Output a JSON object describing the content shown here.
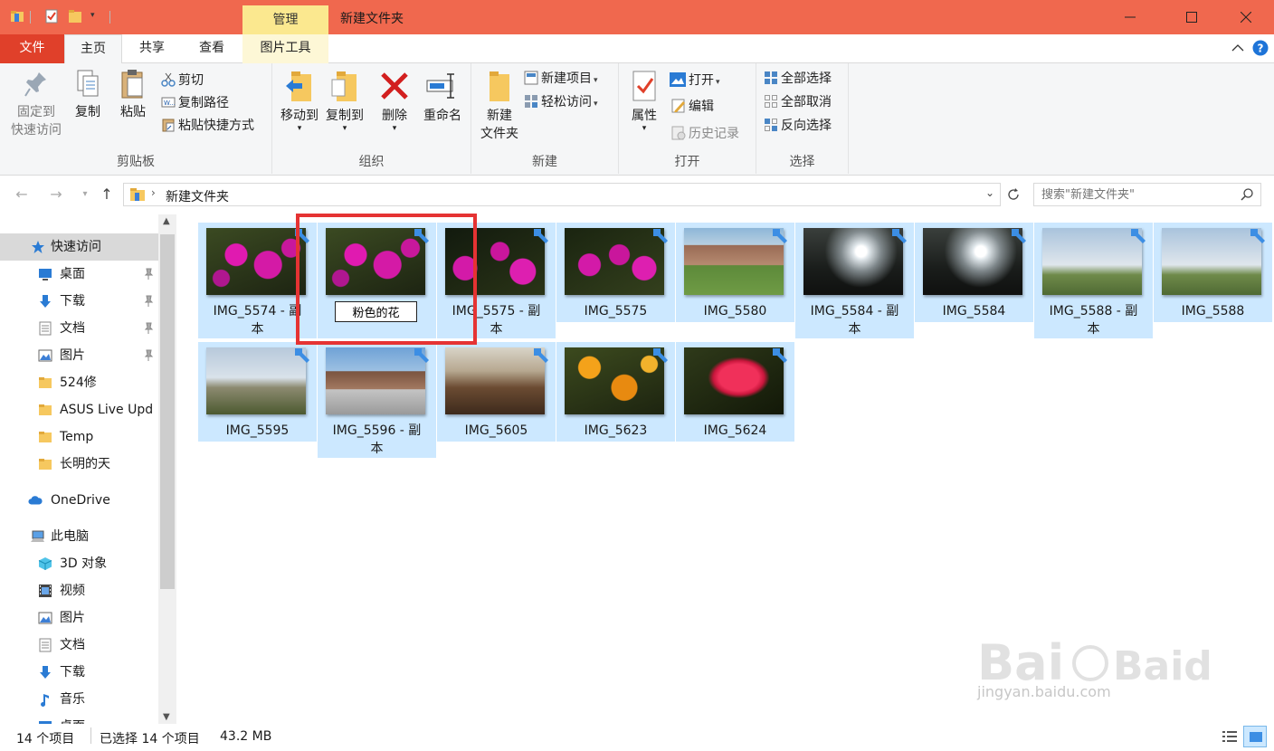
{
  "window": {
    "title": "新建文件夹",
    "context_tab": "管理"
  },
  "tabs": [
    {
      "label": "文件"
    },
    {
      "label": "主页"
    },
    {
      "label": "共享"
    },
    {
      "label": "查看"
    },
    {
      "label": "图片工具"
    }
  ],
  "ribbon": {
    "clipboard": {
      "label": "剪贴板",
      "pin": "固定到\n快速访问",
      "pin_l1": "固定到",
      "pin_l2": "快速访问",
      "copy": "复制",
      "paste": "粘贴",
      "cut": "剪切",
      "copy_path": "复制路径",
      "paste_shortcut": "粘贴快捷方式"
    },
    "organize": {
      "label": "组织",
      "move_to": "移动到",
      "copy_to": "复制到",
      "delete": "删除",
      "rename": "重命名"
    },
    "new": {
      "label": "新建",
      "new_folder_l1": "新建",
      "new_folder_l2": "文件夹",
      "new_item": "新建项目",
      "easy_access": "轻松访问"
    },
    "open": {
      "label": "打开",
      "properties": "属性",
      "open": "打开",
      "edit": "编辑",
      "history": "历史记录"
    },
    "select": {
      "label": "选择",
      "select_all": "全部选择",
      "select_none": "全部取消",
      "invert": "反向选择"
    }
  },
  "address": {
    "path": "新建文件夹",
    "search_placeholder": "搜索\"新建文件夹\""
  },
  "nav": {
    "quick_access": "快速访问",
    "pinned": [
      {
        "label": "桌面",
        "icon": "desktop-icon"
      },
      {
        "label": "下载",
        "icon": "download-icon"
      },
      {
        "label": "文档",
        "icon": "document-icon"
      },
      {
        "label": "图片",
        "icon": "pictures-icon"
      }
    ],
    "folders": [
      {
        "label": "524修"
      },
      {
        "label": "ASUS Live Upd"
      },
      {
        "label": "Temp"
      },
      {
        "label": "长明的天"
      }
    ],
    "onedrive": "OneDrive",
    "this_pc": "此电脑",
    "pc_items": [
      {
        "label": "3D 对象",
        "icon": "3d-objects-icon"
      },
      {
        "label": "视频",
        "icon": "video-icon"
      },
      {
        "label": "图片",
        "icon": "pictures-icon"
      },
      {
        "label": "文档",
        "icon": "document-icon"
      },
      {
        "label": "下载",
        "icon": "download-icon"
      },
      {
        "label": "音乐",
        "icon": "music-icon"
      },
      {
        "label": "桌面",
        "icon": "desktop-icon"
      }
    ]
  },
  "files": [
    {
      "name": "IMG_5574 - 副本",
      "line1": "IMG_5574 - 副",
      "line2": "本",
      "thumb": "pink-flowers"
    },
    {
      "name": "粉色的花",
      "editing": true,
      "thumb": "pink-flowers"
    },
    {
      "name": "IMG_5575 - 副本",
      "line1": "IMG_5575 - 副",
      "line2": "本",
      "thumb": "pink-flowers-dark"
    },
    {
      "name": "IMG_5575",
      "line1": "IMG_5575",
      "line2": "",
      "thumb": "pink-flowers-dark"
    },
    {
      "name": "IMG_5580",
      "line1": "IMG_5580",
      "line2": "",
      "thumb": "building"
    },
    {
      "name": "IMG_5584 - 副本",
      "line1": "IMG_5584 - 副",
      "line2": "本",
      "thumb": "sun-trees"
    },
    {
      "name": "IMG_5584",
      "line1": "IMG_5584",
      "line2": "",
      "thumb": "sun-trees"
    },
    {
      "name": "IMG_5588 - 副本",
      "line1": "IMG_5588 - 副",
      "line2": "本",
      "thumb": "field-sky"
    },
    {
      "name": "IMG_5588",
      "line1": "IMG_5588",
      "line2": "",
      "thumb": "field-sky"
    },
    {
      "name": "IMG_5595",
      "line1": "IMG_5595",
      "line2": "",
      "thumb": "grass-sky"
    },
    {
      "name": "IMG_5596 - 副本",
      "line1": "IMG_5596 - 副",
      "line2": "本",
      "thumb": "gym"
    },
    {
      "name": "IMG_5605",
      "line1": "IMG_5605",
      "line2": "",
      "thumb": "leaves"
    },
    {
      "name": "IMG_5623",
      "line1": "IMG_5623",
      "line2": "",
      "thumb": "orange-flowers"
    },
    {
      "name": "IMG_5624",
      "line1": "IMG_5624",
      "line2": "",
      "thumb": "red-flower"
    }
  ],
  "status": {
    "count": "14 个项目",
    "selected": "已选择 14 个项目",
    "size": "43.2 MB"
  },
  "watermark": {
    "brand": "Baidu经验",
    "url": "jingyan.baidu.com"
  },
  "colors": {
    "titlebar": "#f0684e",
    "file_tab": "#e0402a",
    "context_tab": "#fbe88f",
    "selection": "#cce8ff",
    "highlight_box": "#e53333"
  }
}
